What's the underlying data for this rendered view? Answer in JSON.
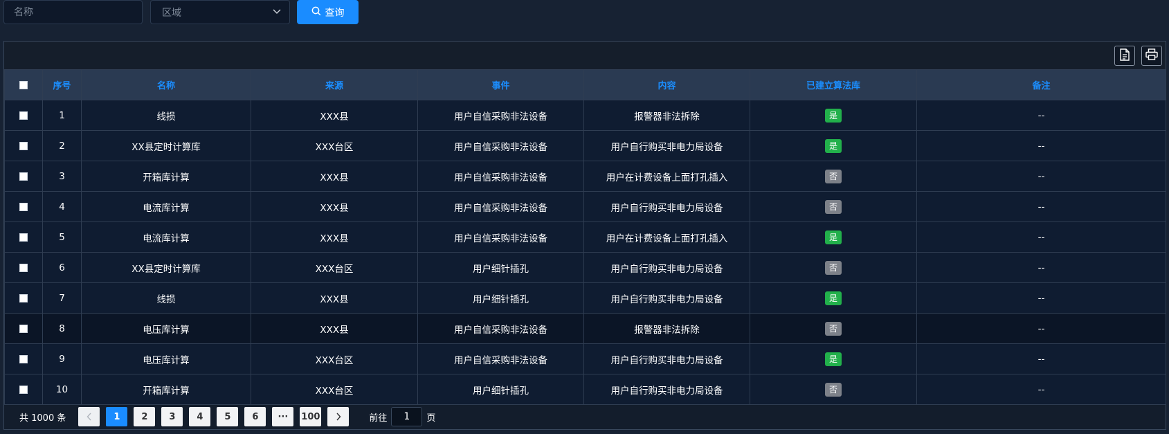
{
  "filters": {
    "name_placeholder": "名称",
    "area_placeholder": "区域",
    "search_label": "查询"
  },
  "toolbar": {
    "export_icon": "document-icon",
    "print_icon": "printer-icon"
  },
  "table": {
    "columns": [
      "序号",
      "名称",
      "来源",
      "事件",
      "内容",
      "已建立算法库",
      "备注"
    ],
    "rows": [
      {
        "no": "1",
        "name": "线损",
        "source": "XXX县",
        "event": "用户自信采购非法设备",
        "content": "报警器非法拆除",
        "built": "是",
        "remark": "--"
      },
      {
        "no": "2",
        "name": "XX县定时计算库",
        "source": "XXX台区",
        "event": "用户自信采购非法设备",
        "content": "用户自行购买非电力局设备",
        "built": "是",
        "remark": "--"
      },
      {
        "no": "3",
        "name": "开箱库计算",
        "source": "XXX县",
        "event": "用户自信采购非法设备",
        "content": "用户在计费设备上面打孔插入",
        "built": "否",
        "remark": "--"
      },
      {
        "no": "4",
        "name": "电流库计算",
        "source": "XXX县",
        "event": "用户自信采购非法设备",
        "content": "用户自行购买非电力局设备",
        "built": "否",
        "remark": "--"
      },
      {
        "no": "5",
        "name": "电流库计算",
        "source": "XXX县",
        "event": "用户自信采购非法设备",
        "content": "用户在计费设备上面打孔插入",
        "built": "是",
        "remark": "--"
      },
      {
        "no": "6",
        "name": "XX县定时计算库",
        "source": "XXX台区",
        "event": "用户细针插孔",
        "content": "用户自行购买非电力局设备",
        "built": "否",
        "remark": "--"
      },
      {
        "no": "7",
        "name": "线损",
        "source": "XXX县",
        "event": "用户细针插孔",
        "content": "用户自行购买非电力局设备",
        "built": "是",
        "remark": "--"
      },
      {
        "no": "8",
        "name": "电压库计算",
        "source": "XXX县",
        "event": "用户自信采购非法设备",
        "content": "报警器非法拆除",
        "built": "否",
        "remark": "--"
      },
      {
        "no": "9",
        "name": "电压库计算",
        "source": "XXX台区",
        "event": "用户自信采购非法设备",
        "content": "用户自行购买非电力局设备",
        "built": "是",
        "remark": "--"
      },
      {
        "no": "10",
        "name": "开箱库计算",
        "source": "XXX台区",
        "event": "用户细针插孔",
        "content": "用户自行购买非电力局设备",
        "built": "否",
        "remark": "--"
      }
    ]
  },
  "pagination": {
    "total": "共 1000 条",
    "pages": [
      "1",
      "2",
      "3",
      "4",
      "5",
      "6",
      "···",
      "100"
    ],
    "current": "1",
    "goto_label": "前往",
    "goto_value": "1",
    "unit": "页"
  },
  "colors": {
    "accent": "#1a8cff",
    "yes_tag": "#22b04b",
    "no_tag": "#7d8189",
    "background": "#172233"
  }
}
